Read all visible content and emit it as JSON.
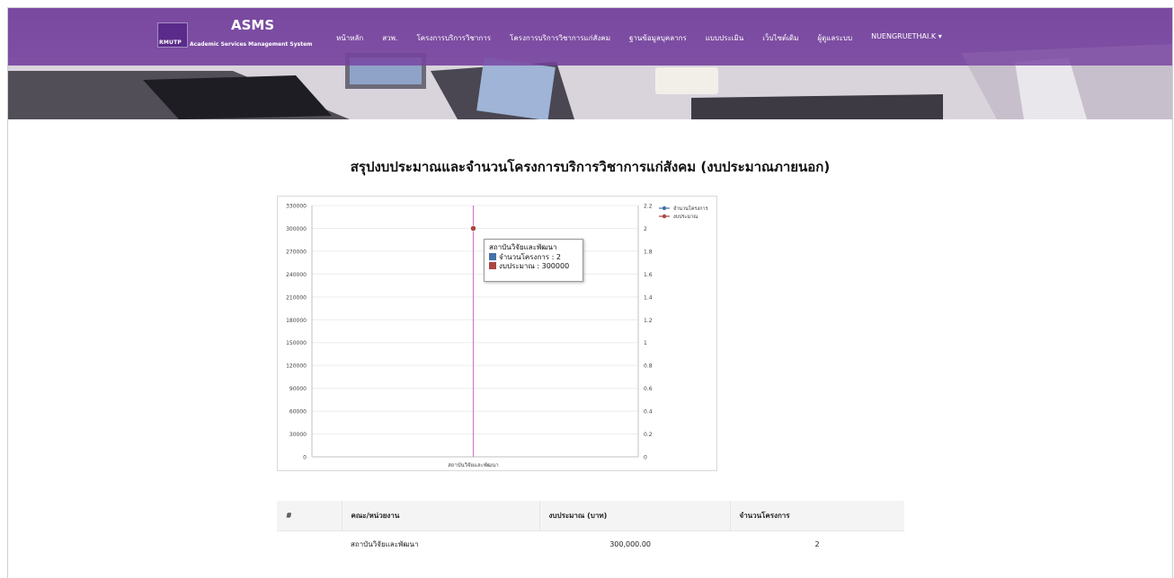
{
  "header": {
    "logo_badge": "RMUTP",
    "logo_title": "ASMS",
    "logo_subtitle": "Academic Services Management System",
    "nav": [
      "หน้าหลัก",
      "สวพ.",
      "โครงการบริการวิชาการ",
      "โครงการบริการวิชาการแก่สังคม",
      "ฐานข้อมูลบุคลากร",
      "แบบประเมิน",
      "เว็บไซต์เดิม",
      "ผู้ดูแลระบบ"
    ],
    "user": "NUENGRUETHAI.K"
  },
  "page": {
    "title": "สรุปงบประมาณและจำนวนโครงการบริการวิชาการแก่สังคม (งบประมาณภายนอก)"
  },
  "chart_data": {
    "type": "line",
    "categories": [
      "สถาบันวิจัยและพัฒนา"
    ],
    "series": [
      {
        "name": "จำนวนโครงการ",
        "values": [
          2
        ],
        "axis": "right",
        "color": "#4572a7"
      },
      {
        "name": "งบประมาณ",
        "values": [
          300000
        ],
        "axis": "left",
        "color": "#aa4643"
      }
    ],
    "y_left": {
      "min": 0,
      "max": 330000,
      "ticks": [
        0,
        30000,
        60000,
        90000,
        120000,
        150000,
        180000,
        210000,
        240000,
        270000,
        300000,
        330000
      ]
    },
    "y_right": {
      "min": 0,
      "max": 2.2,
      "ticks": [
        "0",
        "0.2",
        "0.4",
        "0.6",
        "0.8",
        "1",
        "1.2",
        "1.4",
        "1.6",
        "1.8",
        "2",
        "2.2"
      ]
    },
    "legend": "top-right",
    "grid": true,
    "tooltip": {
      "title": "สถาบันวิจัยและพัฒนา",
      "line1": "จำนวนโครงการ : 2",
      "line2": "งบประมาณ : 300000"
    }
  },
  "table": {
    "headers": [
      "#",
      "คณะ/หน่วยงาน",
      "งบประมาณ (บาท)",
      "จำนวนโครงการ"
    ],
    "rows": [
      {
        "index": "",
        "unit": "สถาบันวิจัยและพัฒนา",
        "budget": "300,000.00",
        "count": "2"
      }
    ]
  },
  "colors": {
    "navbar": "#7640a0",
    "series_count": "#4572a7",
    "series_budget": "#aa4643",
    "crosshair": "#c86fc8"
  }
}
